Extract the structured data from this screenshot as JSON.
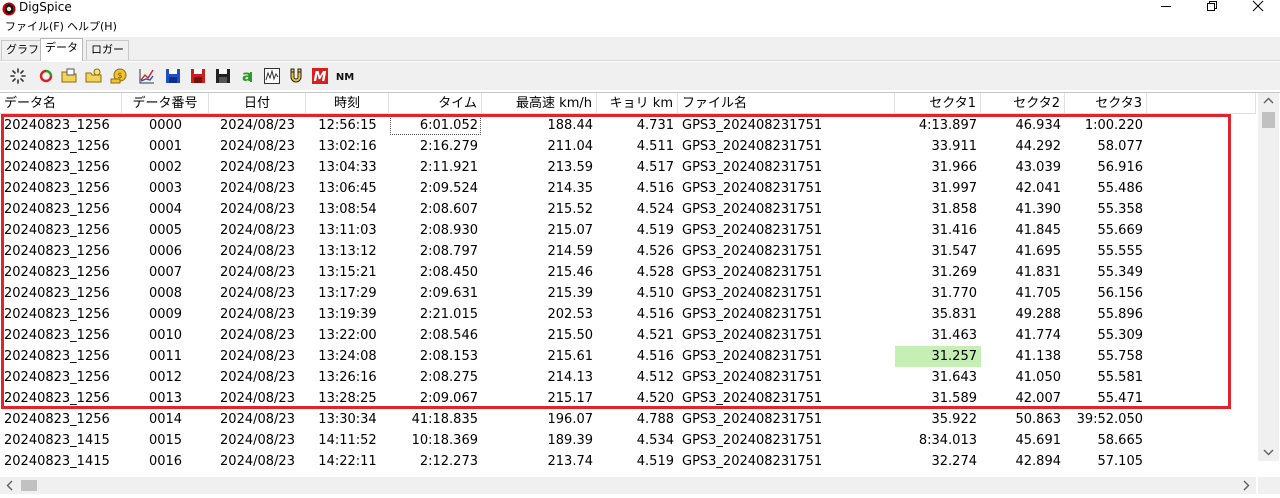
{
  "window": {
    "title": "DigSpice"
  },
  "menu": {
    "file": "ファイル(F)",
    "help": "ヘルプ(H)"
  },
  "tabs": {
    "graph": "グラフ",
    "data": "データ",
    "logger": "ロガー"
  },
  "toolbar": {
    "icons": [
      "loading-spinner-icon",
      "refresh-icon",
      "open-folder-icon",
      "folder-icon",
      "coin-icon",
      "chart-icon",
      "save-blue-icon",
      "save-red-icon",
      "save-black-icon",
      "text-a-icon",
      "waveform-icon",
      "magnet-icon",
      "m-icon",
      "nm-icon"
    ],
    "nm_label": "NM"
  },
  "table": {
    "columns": [
      "データ名",
      "データ番号",
      "日付",
      "時刻",
      "タイム",
      "最高速 km/h",
      "キョリ km",
      "ファイル名",
      "セクタ1",
      "セクタ2",
      "セクタ3",
      ""
    ],
    "rows": [
      [
        "20240823_1256",
        "0000",
        "2024/08/23",
        "12:56:15",
        "6:01.052",
        "188.44",
        "4.731",
        "GPS3_202408231751",
        "4:13.897",
        "46.934",
        "1:00.220",
        ""
      ],
      [
        "20240823_1256",
        "0001",
        "2024/08/23",
        "13:02:16",
        "2:16.279",
        "211.04",
        "4.511",
        "GPS3_202408231751",
        "33.911",
        "44.292",
        "58.077",
        ""
      ],
      [
        "20240823_1256",
        "0002",
        "2024/08/23",
        "13:04:33",
        "2:11.921",
        "213.59",
        "4.517",
        "GPS3_202408231751",
        "31.966",
        "43.039",
        "56.916",
        ""
      ],
      [
        "20240823_1256",
        "0003",
        "2024/08/23",
        "13:06:45",
        "2:09.524",
        "214.35",
        "4.516",
        "GPS3_202408231751",
        "31.997",
        "42.041",
        "55.486",
        ""
      ],
      [
        "20240823_1256",
        "0004",
        "2024/08/23",
        "13:08:54",
        "2:08.607",
        "215.52",
        "4.524",
        "GPS3_202408231751",
        "31.858",
        "41.390",
        "55.358",
        ""
      ],
      [
        "20240823_1256",
        "0005",
        "2024/08/23",
        "13:11:03",
        "2:08.930",
        "215.07",
        "4.519",
        "GPS3_202408231751",
        "31.416",
        "41.845",
        "55.669",
        ""
      ],
      [
        "20240823_1256",
        "0006",
        "2024/08/23",
        "13:13:12",
        "2:08.797",
        "214.59",
        "4.526",
        "GPS3_202408231751",
        "31.547",
        "41.695",
        "55.555",
        ""
      ],
      [
        "20240823_1256",
        "0007",
        "2024/08/23",
        "13:15:21",
        "2:08.450",
        "215.46",
        "4.528",
        "GPS3_202408231751",
        "31.269",
        "41.831",
        "55.349",
        ""
      ],
      [
        "20240823_1256",
        "0008",
        "2024/08/23",
        "13:17:29",
        "2:09.631",
        "215.39",
        "4.510",
        "GPS3_202408231751",
        "31.770",
        "41.705",
        "56.156",
        ""
      ],
      [
        "20240823_1256",
        "0009",
        "2024/08/23",
        "13:19:39",
        "2:21.015",
        "202.53",
        "4.516",
        "GPS3_202408231751",
        "35.831",
        "49.288",
        "55.896",
        ""
      ],
      [
        "20240823_1256",
        "0010",
        "2024/08/23",
        "13:22:00",
        "2:08.546",
        "215.50",
        "4.521",
        "GPS3_202408231751",
        "31.463",
        "41.774",
        "55.309",
        ""
      ],
      [
        "20240823_1256",
        "0011",
        "2024/08/23",
        "13:24:08",
        "2:08.153",
        "215.61",
        "4.516",
        "GPS3_202408231751",
        "31.257",
        "41.138",
        "55.758",
        ""
      ],
      [
        "20240823_1256",
        "0012",
        "2024/08/23",
        "13:26:16",
        "2:08.275",
        "214.13",
        "4.512",
        "GPS3_202408231751",
        "31.643",
        "41.050",
        "55.581",
        ""
      ],
      [
        "20240823_1256",
        "0013",
        "2024/08/23",
        "13:28:25",
        "2:09.067",
        "215.17",
        "4.520",
        "GPS3_202408231751",
        "31.589",
        "42.007",
        "55.471",
        ""
      ],
      [
        "20240823_1256",
        "0014",
        "2024/08/23",
        "13:30:34",
        "41:18.835",
        "196.07",
        "4.788",
        "GPS3_202408231751",
        "35.922",
        "50.863",
        "39:52.050",
        ""
      ],
      [
        "20240823_1415",
        "0015",
        "2024/08/23",
        "14:11:52",
        "10:18.369",
        "189.39",
        "4.534",
        "GPS3_202408231751",
        "8:34.013",
        "45.691",
        "58.665",
        ""
      ],
      [
        "20240823_1415",
        "0016",
        "2024/08/23",
        "14:22:11",
        "2:12.273",
        "213.74",
        "4.519",
        "GPS3_202408231751",
        "32.274",
        "42.894",
        "57.105",
        ""
      ]
    ],
    "best_sector1_row": 11,
    "focused_cell": {
      "row": 0,
      "col": 4
    },
    "selected_rows": [
      0,
      13
    ]
  },
  "colors": {
    "selection_border": "#e0242b",
    "best_highlight": "#c6efb6"
  }
}
